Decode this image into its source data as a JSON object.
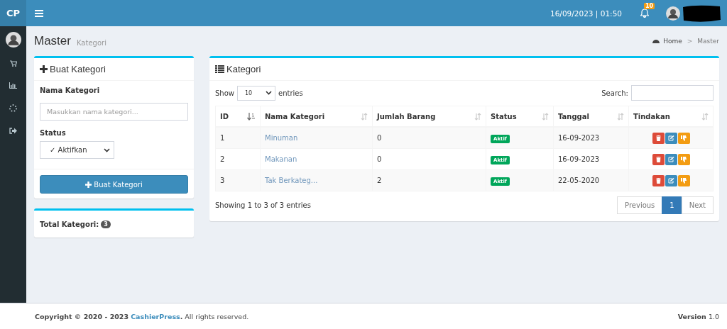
{
  "header": {
    "logo": "CP",
    "datetime": "16/09/2023 | 01:50",
    "notification_count": "10"
  },
  "page": {
    "title": "Master",
    "subtitle": "Kategori",
    "breadcrumb_separator": ">",
    "breadcrumb": [
      {
        "label": "Home",
        "icon": true
      },
      {
        "label": "Master",
        "icon": false
      }
    ]
  },
  "form_box": {
    "title": "Buat Kategori",
    "name_label": "Nama Kategori",
    "name_placeholder": "Masukkan nama kategori...",
    "status_label": "Status",
    "status_value": "✓ Aktifkan",
    "submit": "Buat Kategori"
  },
  "total_box": {
    "label": "Total Kategori:",
    "count": "3"
  },
  "table_box": {
    "title": "Kategori",
    "show_label": "Show",
    "page_size": "10",
    "entries_label": "entries",
    "search_label": "Search:",
    "columns": [
      {
        "label": "ID",
        "sorted": true
      },
      {
        "label": "Nama Kategori",
        "sorted": false
      },
      {
        "label": "Jumlah Barang",
        "sorted": false
      },
      {
        "label": "Status",
        "sorted": false
      },
      {
        "label": "Tanggal",
        "sorted": false
      },
      {
        "label": "Tindakan",
        "sorted": false
      }
    ],
    "rows": [
      {
        "id": "1",
        "name": "Minuman",
        "count": "0",
        "status": "Aktif",
        "date": "16-09-2023"
      },
      {
        "id": "2",
        "name": "Makanan",
        "count": "0",
        "status": "Aktif",
        "date": "16-09-2023"
      },
      {
        "id": "3",
        "name": "Tak Berkateg...",
        "count": "2",
        "status": "Aktif",
        "date": "22-05-2020"
      }
    ],
    "info": "Showing 1 to 3 of 3 entries",
    "pagination": [
      {
        "label": "Previous",
        "selected": false
      },
      {
        "label": "1",
        "selected": true
      },
      {
        "label": "Next",
        "selected": false
      }
    ]
  },
  "footer": {
    "copyright": "Copyright © 2020 - 2023",
    "brand": "CashierPress",
    "rights_mark": ".",
    "rights": "All rights reserved.",
    "version": "**Version** 1.0"
  }
}
